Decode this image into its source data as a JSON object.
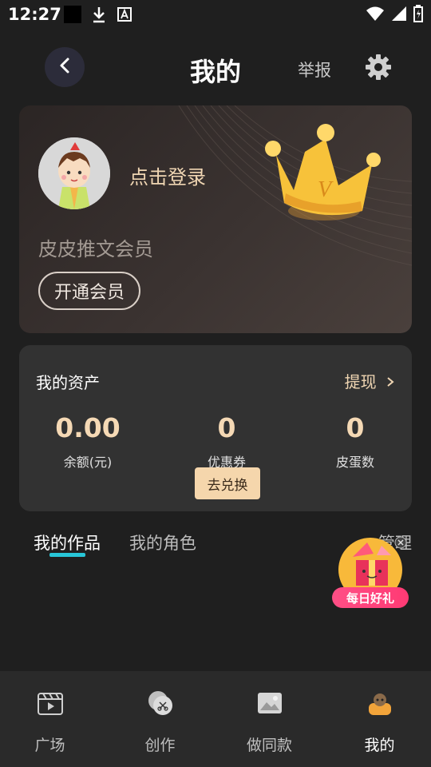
{
  "status_bar": {
    "time": "12:27",
    "icons": [
      "notification-square-icon",
      "download-icon",
      "text-a-icon",
      "wifi-icon",
      "signal-icon",
      "battery-icon"
    ]
  },
  "header": {
    "title": "我的",
    "report_label": "举报",
    "back_icon": "chevron-left-icon",
    "settings_icon": "gear-icon"
  },
  "vip_card": {
    "login_label": "点击登录",
    "member_name": "皮皮推文会员",
    "open_vip_label": "开通会员",
    "crown_badge": "V"
  },
  "assets": {
    "title": "我的资产",
    "withdraw_label": "提现",
    "balance": {
      "value": "0.00",
      "label": "余额(元)"
    },
    "coupons": {
      "value": "0",
      "label": "优惠券"
    },
    "eggs": {
      "value": "0",
      "label": "皮蛋数"
    },
    "exchange_label": "去兑换"
  },
  "tabs": {
    "works": "我的作品",
    "roles": "我的角色",
    "manage": "管理"
  },
  "floating_gift": {
    "label": "每日好礼"
  },
  "bottom_nav": {
    "items": [
      {
        "label": "广场",
        "icon": "video-play-icon"
      },
      {
        "label": "创作",
        "icon": "scissors-icon"
      },
      {
        "label": "做同款",
        "icon": "image-icon"
      },
      {
        "label": "我的",
        "icon": "user-icon"
      }
    ]
  },
  "colors": {
    "background": "#1f1f1f",
    "accent_gold": "#f5d9b5",
    "tab_underline": "#28c6d8",
    "gift_pink": "#ff3a74"
  }
}
